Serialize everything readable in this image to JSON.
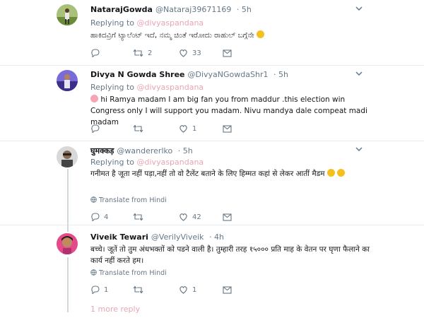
{
  "common": {
    "replying_to": "Replying to",
    "mention": "@divyaspandana"
  },
  "tweets": [
    {
      "name": "NatarajGowda",
      "handle": "@Nataraj39671169",
      "time": "· 5h",
      "text": "ಹಾಕಿದವ್ರಿಗೆ ಟ್ಯಾಲೆಂಟ್ ಇದೆ, ನಮ್ಮ ಚಿಂತೆ ಇರೋದು ರಾಹುಲ್ ಬಗ್ಗೆನೇ",
      "translate": "",
      "replies": "",
      "retweets": "2",
      "likes": "33",
      "emoji": "smile"
    },
    {
      "name": "Divya N Gowda Shree",
      "handle": "@DivyaNGowdaShr1",
      "time": "· 5h",
      "text": "hi Ramya madam I am big fan you from maddur .this election win Congress only I will support you madam. Nivu mandya dale compeat madi madam",
      "translate": "",
      "replies": "",
      "retweets": "",
      "likes": "1",
      "emoji": "woman"
    },
    {
      "name": "घुमक्कड़",
      "handle": "@wandererlko",
      "time": "· 5h",
      "text": "गनीमत है जूता नहीं पड़ा,नहीं तो वो टैलेंट बताने के लिए हिम्मत कहां से लेकर आतीं मैडम",
      "translate": "Translate from Hindi",
      "replies": "4",
      "retweets": "",
      "likes": "42",
      "emoji": "laugh"
    },
    {
      "name": "Viveik Tewari",
      "handle": "@VerilyViveik",
      "time": "· 4h",
      "text": "बच्चे। जूतें तो तुम अंधभक्तों को पडने वाली है। तुम्हारी तरह १५००० प्रति माह के वेतन पर घृणा फैलाने का कार्य नहीं करते हम।",
      "translate": "Translate from Hindi",
      "replies": "1",
      "retweets": "",
      "likes": "1",
      "emoji": ""
    }
  ],
  "more_replies": "1 more reply",
  "icons": {
    "reply": "reply-icon",
    "retweet": "retweet-icon",
    "like": "heart-icon",
    "dm": "message-icon",
    "caret": "chevron-down-icon"
  }
}
